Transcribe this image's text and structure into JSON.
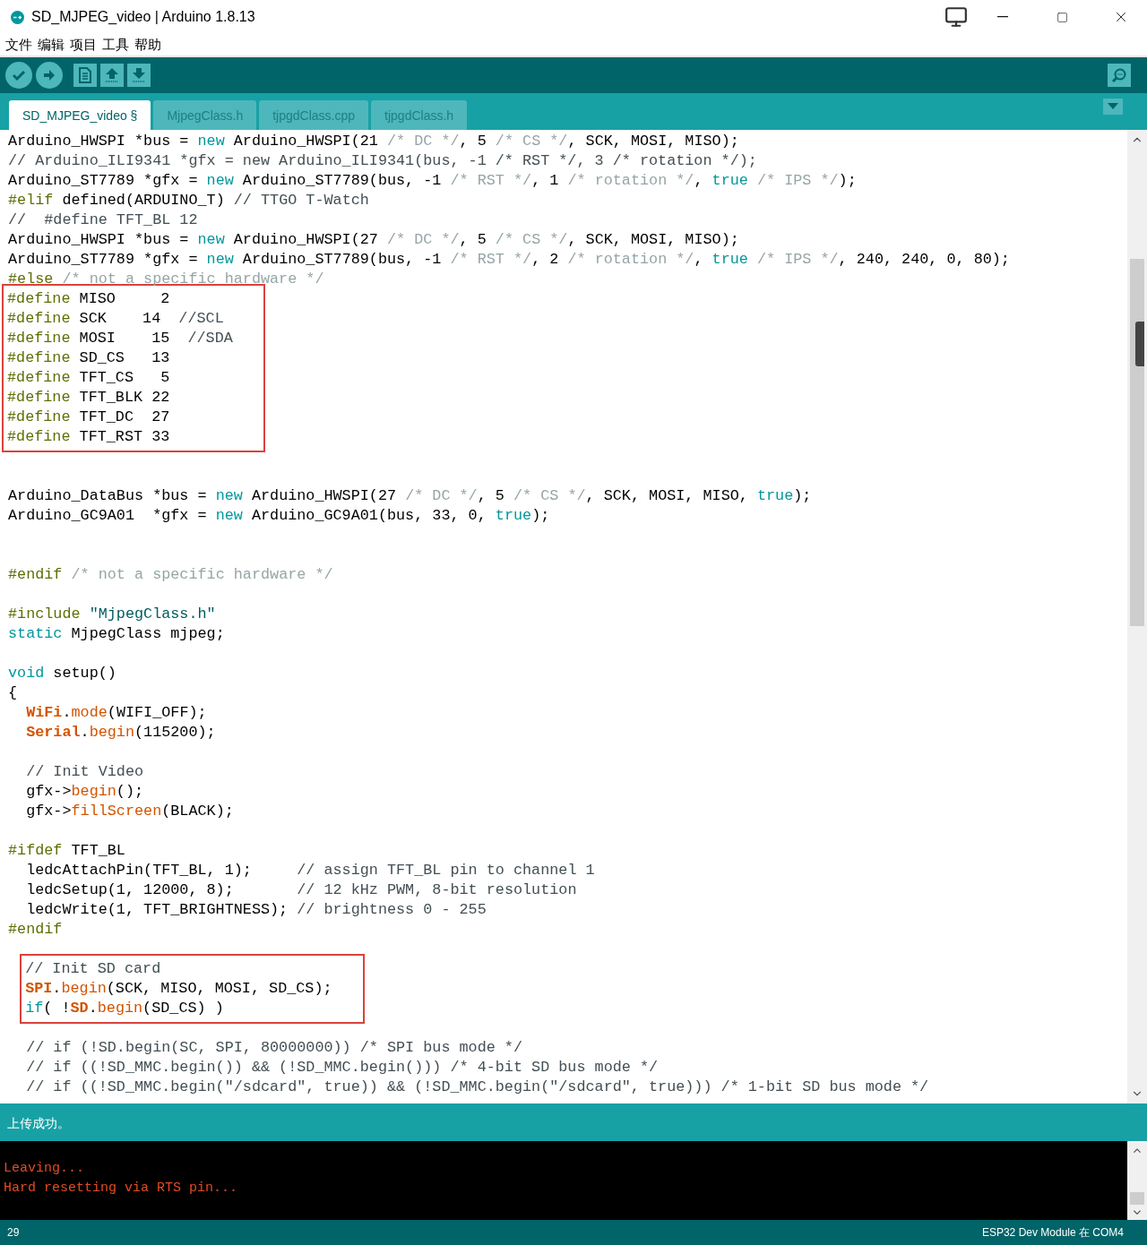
{
  "window": {
    "title": "SD_MJPEG_video | Arduino 1.8.13"
  },
  "menu": [
    "文件",
    "编辑",
    "项目",
    "工具",
    "帮助"
  ],
  "toolbar": {
    "buttons": [
      {
        "kind": "verify"
      },
      {
        "kind": "upload"
      },
      {
        "kind": "new"
      },
      {
        "kind": "open"
      },
      {
        "kind": "save"
      },
      {
        "kind": "serial_monitor"
      }
    ]
  },
  "tabs": [
    {
      "label": "SD_MJPEG_video §",
      "selected": true
    },
    {
      "label": "MjpegClass.h",
      "selected": false
    },
    {
      "label": "tjpgdClass.cpp",
      "selected": false
    },
    {
      "label": "tjpgdClass.h",
      "selected": false
    }
  ],
  "code": [
    {
      "kind": "line",
      "segments": [
        {
          "kind": "p",
          "text": "Arduino_HWSPI *bus = "
        },
        {
          "kind": "kw",
          "text": "new"
        },
        {
          "kind": "p",
          "text": " Arduino_HWSPI(21 "
        },
        {
          "kind": "bc",
          "text": "/* DC */"
        },
        {
          "kind": "p",
          "text": ", 5 "
        },
        {
          "kind": "bc",
          "text": "/* CS */"
        },
        {
          "kind": "p",
          "text": ", SCK, MOSI, MISO);"
        }
      ]
    },
    {
      "kind": "line",
      "segments": [
        {
          "kind": "lc",
          "text": "// Arduino_ILI9341 *gfx = new Arduino_ILI9341(bus, -1 /* RST */, 3 /* rotation */);"
        }
      ]
    },
    {
      "kind": "line",
      "segments": [
        {
          "kind": "p",
          "text": "Arduino_ST7789 *gfx = "
        },
        {
          "kind": "kw",
          "text": "new"
        },
        {
          "kind": "p",
          "text": " Arduino_ST7789(bus, -1 "
        },
        {
          "kind": "bc",
          "text": "/* RST */"
        },
        {
          "kind": "p",
          "text": ", 1 "
        },
        {
          "kind": "bc",
          "text": "/* rotation */"
        },
        {
          "kind": "p",
          "text": ", "
        },
        {
          "kind": "kw",
          "text": "true"
        },
        {
          "kind": "bc",
          "text": " /* IPS */"
        },
        {
          "kind": "p",
          "text": ");"
        }
      ]
    },
    {
      "kind": "line",
      "segments": [
        {
          "kind": "pp",
          "text": "#elif"
        },
        {
          "kind": "p",
          "text": " defined(ARDUINO_T) "
        },
        {
          "kind": "lc",
          "text": "// TTGO T-Watch"
        }
      ]
    },
    {
      "kind": "line",
      "segments": [
        {
          "kind": "lc",
          "text": "//  #define TFT_BL 12"
        }
      ]
    },
    {
      "kind": "line",
      "segments": [
        {
          "kind": "p",
          "text": "Arduino_HWSPI *bus = "
        },
        {
          "kind": "kw",
          "text": "new"
        },
        {
          "kind": "p",
          "text": " Arduino_HWSPI(27 "
        },
        {
          "kind": "bc",
          "text": "/* DC */"
        },
        {
          "kind": "p",
          "text": ", 5 "
        },
        {
          "kind": "bc",
          "text": "/* CS */"
        },
        {
          "kind": "p",
          "text": ", SCK, MOSI, MISO);"
        }
      ]
    },
    {
      "kind": "line",
      "segments": [
        {
          "kind": "p",
          "text": "Arduino_ST7789 *gfx = "
        },
        {
          "kind": "kw",
          "text": "new"
        },
        {
          "kind": "p",
          "text": " Arduino_ST7789(bus, -1 "
        },
        {
          "kind": "bc",
          "text": "/* RST */"
        },
        {
          "kind": "p",
          "text": ", 2 "
        },
        {
          "kind": "bc",
          "text": "/* rotation */"
        },
        {
          "kind": "p",
          "text": ", "
        },
        {
          "kind": "kw",
          "text": "true"
        },
        {
          "kind": "bc",
          "text": " /* IPS */"
        },
        {
          "kind": "p",
          "text": ", 240, 240, 0, 80);"
        }
      ]
    },
    {
      "kind": "line",
      "segments": [
        {
          "kind": "pp",
          "text": "#else"
        },
        {
          "kind": "bc",
          "text": " /* not a specific hardware */"
        }
      ]
    },
    {
      "kind": "box",
      "lines": [
        [
          {
            "kind": "pp",
            "text": "#define"
          },
          {
            "kind": "p",
            "text": " MISO     2"
          }
        ],
        [
          {
            "kind": "pp",
            "text": "#define"
          },
          {
            "kind": "p",
            "text": " SCK    14  "
          },
          {
            "kind": "lc",
            "text": "//SCL"
          }
        ],
        [
          {
            "kind": "pp",
            "text": "#define"
          },
          {
            "kind": "p",
            "text": " MOSI    15  "
          },
          {
            "kind": "lc",
            "text": "//SDA"
          }
        ],
        [
          {
            "kind": "pp",
            "text": "#define"
          },
          {
            "kind": "p",
            "text": " SD_CS   13"
          }
        ],
        [
          {
            "kind": "pp",
            "text": "#define"
          },
          {
            "kind": "p",
            "text": " TFT_CS   5"
          }
        ],
        [
          {
            "kind": "pp",
            "text": "#define"
          },
          {
            "kind": "p",
            "text": " TFT_BLK 22"
          }
        ],
        [
          {
            "kind": "pp",
            "text": "#define"
          },
          {
            "kind": "p",
            "text": " TFT_DC  27"
          }
        ],
        [
          {
            "kind": "pp",
            "text": "#define"
          },
          {
            "kind": "p",
            "text": " TFT_RST 33"
          }
        ]
      ]
    },
    {
      "kind": "blank"
    },
    {
      "kind": "blank"
    },
    {
      "kind": "line",
      "segments": [
        {
          "kind": "p",
          "text": "Arduino_DataBus *bus = "
        },
        {
          "kind": "kw",
          "text": "new"
        },
        {
          "kind": "p",
          "text": " Arduino_HWSPI(27 "
        },
        {
          "kind": "bc",
          "text": "/* DC */"
        },
        {
          "kind": "p",
          "text": ", 5 "
        },
        {
          "kind": "bc",
          "text": "/* CS */"
        },
        {
          "kind": "p",
          "text": ", SCK, MOSI, MISO, "
        },
        {
          "kind": "kw",
          "text": "true"
        },
        {
          "kind": "p",
          "text": ");"
        }
      ]
    },
    {
      "kind": "line",
      "segments": [
        {
          "kind": "p",
          "text": "Arduino_GC9A01  *gfx = "
        },
        {
          "kind": "kw",
          "text": "new"
        },
        {
          "kind": "p",
          "text": " Arduino_GC9A01(bus, 33, 0, "
        },
        {
          "kind": "kw",
          "text": "true"
        },
        {
          "kind": "p",
          "text": ");"
        }
      ]
    },
    {
      "kind": "blank"
    },
    {
      "kind": "blank"
    },
    {
      "kind": "line",
      "segments": [
        {
          "kind": "pp",
          "text": "#endif"
        },
        {
          "kind": "bc",
          "text": " /* not a specific hardware */"
        }
      ]
    },
    {
      "kind": "blank"
    },
    {
      "kind": "line",
      "segments": [
        {
          "kind": "pp",
          "text": "#include"
        },
        {
          "kind": "str",
          "text": " \"MjpegClass.h\""
        }
      ]
    },
    {
      "kind": "line",
      "segments": [
        {
          "kind": "kw",
          "text": "static"
        },
        {
          "kind": "p",
          "text": " MjpegClass mjpeg;"
        }
      ]
    },
    {
      "kind": "blank"
    },
    {
      "kind": "line",
      "segments": [
        {
          "kind": "kw",
          "text": "void"
        },
        {
          "kind": "p",
          "text": " setup()"
        }
      ]
    },
    {
      "kind": "line",
      "segments": [
        {
          "kind": "p",
          "text": "{"
        }
      ]
    },
    {
      "kind": "line",
      "segments": [
        {
          "kind": "cls",
          "text": "  WiFi"
        },
        {
          "kind": "p",
          "text": "."
        },
        {
          "kind": "fn",
          "text": "mode"
        },
        {
          "kind": "p",
          "text": "(WIFI_OFF);"
        }
      ]
    },
    {
      "kind": "line",
      "segments": [
        {
          "kind": "cls",
          "text": "  Serial"
        },
        {
          "kind": "p",
          "text": "."
        },
        {
          "kind": "fn",
          "text": "begin"
        },
        {
          "kind": "p",
          "text": "(115200);"
        }
      ]
    },
    {
      "kind": "blank"
    },
    {
      "kind": "line",
      "segments": [
        {
          "kind": "lc",
          "text": "  // Init Video"
        }
      ]
    },
    {
      "kind": "line",
      "segments": [
        {
          "kind": "p",
          "text": "  gfx->"
        },
        {
          "kind": "fn",
          "text": "begin"
        },
        {
          "kind": "p",
          "text": "();"
        }
      ]
    },
    {
      "kind": "line",
      "segments": [
        {
          "kind": "p",
          "text": "  gfx->"
        },
        {
          "kind": "fn",
          "text": "fillScreen"
        },
        {
          "kind": "p",
          "text": "(BLACK);"
        }
      ]
    },
    {
      "kind": "blank"
    },
    {
      "kind": "line",
      "segments": [
        {
          "kind": "pp",
          "text": "#ifdef"
        },
        {
          "kind": "p",
          "text": " TFT_BL"
        }
      ]
    },
    {
      "kind": "line",
      "segments": [
        {
          "kind": "p",
          "text": "  ledcAttachPin(TFT_BL, 1);     "
        },
        {
          "kind": "lc",
          "text": "// assign TFT_BL pin to channel 1"
        }
      ]
    },
    {
      "kind": "line",
      "segments": [
        {
          "kind": "p",
          "text": "  ledcSetup(1, 12000, 8);       "
        },
        {
          "kind": "lc",
          "text": "// 12 kHz PWM, 8-bit resolution"
        }
      ]
    },
    {
      "kind": "line",
      "segments": [
        {
          "kind": "p",
          "text": "  ledcWrite(1, TFT_BRIGHTNESS); "
        },
        {
          "kind": "lc",
          "text": "// brightness 0 - 255"
        }
      ]
    },
    {
      "kind": "line",
      "segments": [
        {
          "kind": "pp",
          "text": "#endif"
        }
      ]
    },
    {
      "kind": "blank"
    },
    {
      "kind": "box",
      "lines": [
        [
          {
            "kind": "lc",
            "text": "  // Init SD card"
          }
        ],
        [
          {
            "kind": "cls",
            "text": "  SPI"
          },
          {
            "kind": "p",
            "text": "."
          },
          {
            "kind": "fn",
            "text": "begin"
          },
          {
            "kind": "p",
            "text": "(SCK, MISO, MOSI, SD_CS);"
          }
        ],
        [
          {
            "kind": "kw",
            "text": "  if"
          },
          {
            "kind": "p",
            "text": "( !"
          },
          {
            "kind": "cls",
            "text": "SD"
          },
          {
            "kind": "p",
            "text": "."
          },
          {
            "kind": "fn",
            "text": "begin"
          },
          {
            "kind": "p",
            "text": "(SD_CS) )"
          }
        ]
      ]
    },
    {
      "kind": "blank"
    },
    {
      "kind": "line",
      "segments": [
        {
          "kind": "lc",
          "text": "  // if (!SD.begin(SC, SPI, 80000000)) /* SPI bus mode */"
        }
      ]
    },
    {
      "kind": "line",
      "segments": [
        {
          "kind": "lc",
          "text": "  // if ((!SD_MMC.begin()) && (!SD_MMC.begin())) /* 4-bit SD bus mode */"
        }
      ]
    },
    {
      "kind": "line",
      "segments": [
        {
          "kind": "lc",
          "text": "  // if ((!SD_MMC.begin(\"/sdcard\", true)) && (!SD_MMC.begin(\"/sdcard\", true))) /* 1-bit SD bus mode */"
        }
      ]
    }
  ],
  "message": "上传成功。",
  "console": [
    "Leaving...",
    "Hard resetting via RTS pin..."
  ],
  "status_bar": {
    "line": "29",
    "board": "ESP32 Dev Module 在 COM4"
  }
}
